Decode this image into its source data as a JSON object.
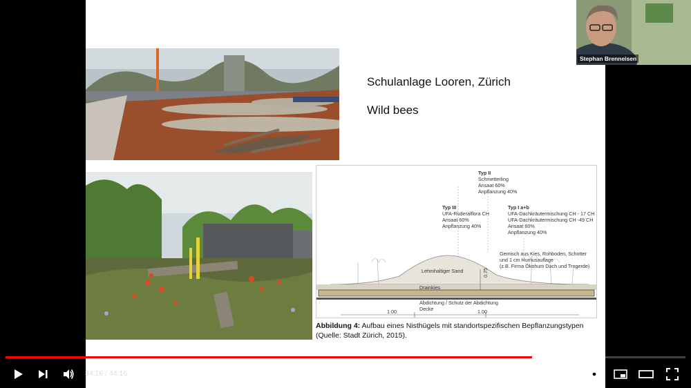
{
  "slide": {
    "title_line1": "Schulanlage Looren, Zürich",
    "title_line2": "Wild bees",
    "diagram": {
      "typ2_title": "Typ II",
      "typ2_l1": "Schmetterling",
      "typ2_l2": "Ansaat 60%",
      "typ2_l3": "Anpflanzung 40%",
      "typ3_title": "Typ III",
      "typ3_l1": "UFA-Ruderalflora CH",
      "typ3_l2": "Ansaat 60%",
      "typ3_l3": "Anpflanzung 40%",
      "typ1_title": "Typ I a+b",
      "typ1_l1": "UFA-Dachkräutermischung CH - 17 CH",
      "typ1_l2": "UFA-Dachkräutermischung CH -49 CH",
      "typ1_l3": "Ansaat 60%",
      "typ1_l4": "Anpflanzung 40%",
      "mix_l1": "Gemisch aus Kies, Rohboden, Schotter",
      "mix_l2": "und 1 cm Humusauflage",
      "mix_l3": "(z.B. Firma Ökohum Dach und Trogerde)",
      "sand": "Lehmhaltiger Sand",
      "height": "0.75",
      "drain": "Drainkies",
      "seal": "Abdichtung / Schutz der Abdichtung",
      "deck": "Decke",
      "dim_left": "1.00",
      "dim_right": "1.00"
    },
    "caption_bold": "Abbildung 4:",
    "caption_text": " Aufbau eines Nisthügels mit standortspezifischen Bepflanzungstypen",
    "caption_line2": "(Quelle: Stadt Zürich, 2015)."
  },
  "webcam": {
    "name": "Stephan Brenneisen"
  },
  "player": {
    "current_time": "34:16",
    "separator": " / ",
    "duration": "44:16",
    "progress_played": 0.774,
    "progress_buffered": 0.79,
    "accent": "#ff0000"
  },
  "icons": [
    "play-icon",
    "next-icon",
    "volume-icon",
    "captions-icon",
    "settings-icon",
    "miniplayer-icon",
    "theater-icon",
    "fullscreen-icon"
  ]
}
